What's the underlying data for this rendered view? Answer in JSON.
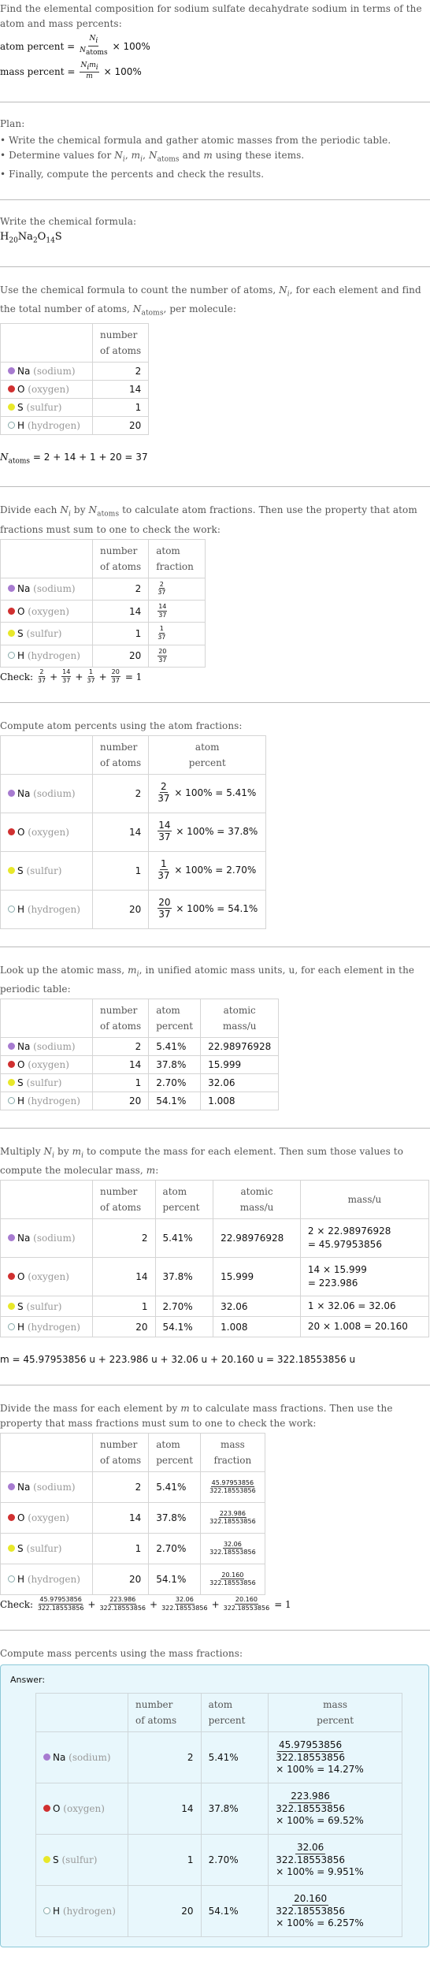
{
  "intro": {
    "question": "Find the elemental composition for sodium sulfate decahydrate sodium in terms of the atom and mass percents:",
    "atom_percent_label": "atom percent =",
    "mass_percent_label": "mass percent =",
    "times_100": "× 100%"
  },
  "plan": {
    "title": "Plan:",
    "items": [
      "Write the chemical formula and gather atomic masses from the periodic table.",
      "Determine values for N_i, m_i, N_atoms and m using these items.",
      "Finally, compute the percents and check the results."
    ]
  },
  "formula_step": {
    "prompt": "Write the chemical formula:",
    "formula": [
      {
        "el": "H",
        "n": "20"
      },
      {
        "el": "Na",
        "n": "2"
      },
      {
        "el": "O",
        "n": "14"
      },
      {
        "el": "S",
        "n": ""
      }
    ]
  },
  "elements": [
    {
      "symbol": "Na",
      "name": "(sodium)",
      "color": "#a77bd0",
      "atoms": "2",
      "fraction_num": "2",
      "atom_percent": "5.41%",
      "atomic_mass": "22.98976928",
      "mass_expr": "2 × 22.98976928",
      "mass_result": "= 45.97953856",
      "mass": "45.97953856",
      "mass_percent": "14.27%"
    },
    {
      "symbol": "O",
      "name": "(oxygen)",
      "color": "#d03030",
      "atoms": "14",
      "fraction_num": "14",
      "atom_percent": "37.8%",
      "atomic_mass": "15.999",
      "mass_expr": "14 × 15.999",
      "mass_result": "= 223.986",
      "mass": "223.986",
      "mass_percent": "69.52%"
    },
    {
      "symbol": "S",
      "name": "(sulfur)",
      "color": "#e8e82a",
      "atoms": "1",
      "fraction_num": "1",
      "atom_percent": "2.70%",
      "atomic_mass": "32.06",
      "mass_expr": "1 × 32.06 = 32.06",
      "mass_result": "",
      "mass": "32.06",
      "mass_percent": "9.951%"
    },
    {
      "symbol": "H",
      "name": "(hydrogen)",
      "color": "#ffffff",
      "atoms": "20",
      "fraction_num": "20",
      "atom_percent": "54.1%",
      "atomic_mass": "1.008",
      "mass_expr": "20 × 1.008 = 20.160",
      "mass_result": "",
      "mass": "20.160",
      "mass_percent": "6.257%"
    }
  ],
  "count_step": {
    "prompt": "Use the chemical formula to count the number of atoms, N_i, for each element and find the total number of atoms, N_atoms, per molecule:",
    "sum": "= 2 + 14 + 1 + 20 = 37",
    "total": "37"
  },
  "fraction_step": {
    "prompt": "Divide each N_i by N_atoms to calculate atom fractions. Then use the property that atom fractions must sum to one to check the work:",
    "check_label": "Check:",
    "check_result": "= 1"
  },
  "atom_percent_step": {
    "prompt": "Compute atom percents using the atom fractions:"
  },
  "mass_lookup_step": {
    "prompt": "Look up the atomic mass, m_i, in unified atomic mass units, u, for each element in the periodic table:"
  },
  "mass_step": {
    "prompt": "Multiply N_i by m_i to compute the mass for each element. Then sum those values to compute the molecular mass, m:",
    "sum_line": "m = 45.97953856 u + 223.986 u + 32.06 u + 20.160 u = 322.18553856 u",
    "molecular_mass": "322.18553856"
  },
  "mass_fraction_step": {
    "prompt": "Divide the mass for each element by m to calculate mass fractions. Then use the property that mass fractions must sum to one to check the work:",
    "check_label": "Check:",
    "check_result": "= 1"
  },
  "mass_percent_step": {
    "prompt": "Compute mass percents using the mass fractions:",
    "answer_label": "Answer:"
  },
  "headers": {
    "number_of_atoms": [
      "number",
      "of atoms"
    ],
    "atom_fraction": [
      "atom",
      "fraction"
    ],
    "atom_percent": [
      "atom",
      "percent"
    ],
    "atomic_mass": [
      "atomic",
      "mass/u"
    ],
    "mass": "mass/u",
    "mass_fraction": [
      "mass",
      "fraction"
    ],
    "mass_percent": [
      "mass",
      "percent"
    ]
  }
}
